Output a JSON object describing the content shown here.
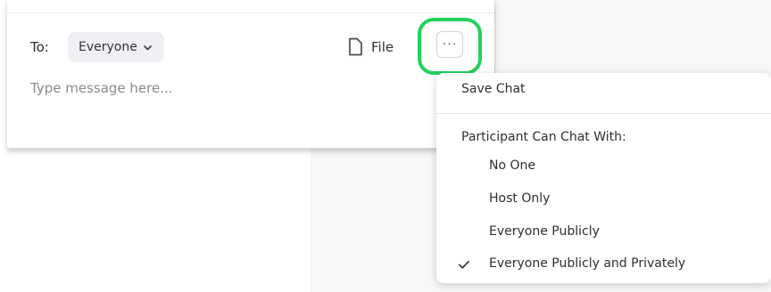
{
  "chat": {
    "to_label": "To:",
    "recipient": "Everyone",
    "file_label": "File",
    "more_label": "···",
    "message_placeholder": "Type message here..."
  },
  "menu": {
    "save_chat": "Save Chat",
    "participant_heading": "Participant Can Chat With:",
    "options": [
      {
        "label": "No One",
        "selected": false
      },
      {
        "label": "Host Only",
        "selected": false
      },
      {
        "label": "Everyone Publicly",
        "selected": false
      },
      {
        "label": "Everyone Publicly and Privately",
        "selected": true
      }
    ]
  },
  "icons": {
    "recipient_dropdown": "chevron-down-icon",
    "file": "file-icon",
    "more": "more-horizontal-icon",
    "selected_option": "check-icon"
  },
  "colors": {
    "highlight": "#23d15c",
    "chip_background": "#eef0f4",
    "placeholder": "#8a8a92",
    "menu_border": "#e7e7ea"
  }
}
